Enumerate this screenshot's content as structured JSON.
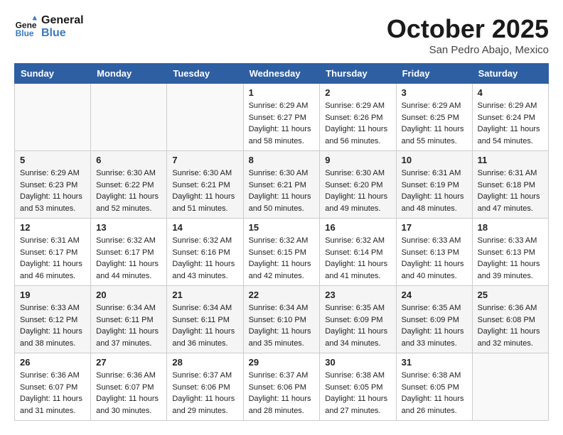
{
  "header": {
    "logo_line1": "General",
    "logo_line2": "Blue",
    "month": "October 2025",
    "location": "San Pedro Abajo, Mexico"
  },
  "weekdays": [
    "Sunday",
    "Monday",
    "Tuesday",
    "Wednesday",
    "Thursday",
    "Friday",
    "Saturday"
  ],
  "weeks": [
    [
      {
        "day": "",
        "sunrise": "",
        "sunset": "",
        "daylight": ""
      },
      {
        "day": "",
        "sunrise": "",
        "sunset": "",
        "daylight": ""
      },
      {
        "day": "",
        "sunrise": "",
        "sunset": "",
        "daylight": ""
      },
      {
        "day": "1",
        "sunrise": "Sunrise: 6:29 AM",
        "sunset": "Sunset: 6:27 PM",
        "daylight": "Daylight: 11 hours and 58 minutes."
      },
      {
        "day": "2",
        "sunrise": "Sunrise: 6:29 AM",
        "sunset": "Sunset: 6:26 PM",
        "daylight": "Daylight: 11 hours and 56 minutes."
      },
      {
        "day": "3",
        "sunrise": "Sunrise: 6:29 AM",
        "sunset": "Sunset: 6:25 PM",
        "daylight": "Daylight: 11 hours and 55 minutes."
      },
      {
        "day": "4",
        "sunrise": "Sunrise: 6:29 AM",
        "sunset": "Sunset: 6:24 PM",
        "daylight": "Daylight: 11 hours and 54 minutes."
      }
    ],
    [
      {
        "day": "5",
        "sunrise": "Sunrise: 6:29 AM",
        "sunset": "Sunset: 6:23 PM",
        "daylight": "Daylight: 11 hours and 53 minutes."
      },
      {
        "day": "6",
        "sunrise": "Sunrise: 6:30 AM",
        "sunset": "Sunset: 6:22 PM",
        "daylight": "Daylight: 11 hours and 52 minutes."
      },
      {
        "day": "7",
        "sunrise": "Sunrise: 6:30 AM",
        "sunset": "Sunset: 6:21 PM",
        "daylight": "Daylight: 11 hours and 51 minutes."
      },
      {
        "day": "8",
        "sunrise": "Sunrise: 6:30 AM",
        "sunset": "Sunset: 6:21 PM",
        "daylight": "Daylight: 11 hours and 50 minutes."
      },
      {
        "day": "9",
        "sunrise": "Sunrise: 6:30 AM",
        "sunset": "Sunset: 6:20 PM",
        "daylight": "Daylight: 11 hours and 49 minutes."
      },
      {
        "day": "10",
        "sunrise": "Sunrise: 6:31 AM",
        "sunset": "Sunset: 6:19 PM",
        "daylight": "Daylight: 11 hours and 48 minutes."
      },
      {
        "day": "11",
        "sunrise": "Sunrise: 6:31 AM",
        "sunset": "Sunset: 6:18 PM",
        "daylight": "Daylight: 11 hours and 47 minutes."
      }
    ],
    [
      {
        "day": "12",
        "sunrise": "Sunrise: 6:31 AM",
        "sunset": "Sunset: 6:17 PM",
        "daylight": "Daylight: 11 hours and 46 minutes."
      },
      {
        "day": "13",
        "sunrise": "Sunrise: 6:32 AM",
        "sunset": "Sunset: 6:17 PM",
        "daylight": "Daylight: 11 hours and 44 minutes."
      },
      {
        "day": "14",
        "sunrise": "Sunrise: 6:32 AM",
        "sunset": "Sunset: 6:16 PM",
        "daylight": "Daylight: 11 hours and 43 minutes."
      },
      {
        "day": "15",
        "sunrise": "Sunrise: 6:32 AM",
        "sunset": "Sunset: 6:15 PM",
        "daylight": "Daylight: 11 hours and 42 minutes."
      },
      {
        "day": "16",
        "sunrise": "Sunrise: 6:32 AM",
        "sunset": "Sunset: 6:14 PM",
        "daylight": "Daylight: 11 hours and 41 minutes."
      },
      {
        "day": "17",
        "sunrise": "Sunrise: 6:33 AM",
        "sunset": "Sunset: 6:13 PM",
        "daylight": "Daylight: 11 hours and 40 minutes."
      },
      {
        "day": "18",
        "sunrise": "Sunrise: 6:33 AM",
        "sunset": "Sunset: 6:13 PM",
        "daylight": "Daylight: 11 hours and 39 minutes."
      }
    ],
    [
      {
        "day": "19",
        "sunrise": "Sunrise: 6:33 AM",
        "sunset": "Sunset: 6:12 PM",
        "daylight": "Daylight: 11 hours and 38 minutes."
      },
      {
        "day": "20",
        "sunrise": "Sunrise: 6:34 AM",
        "sunset": "Sunset: 6:11 PM",
        "daylight": "Daylight: 11 hours and 37 minutes."
      },
      {
        "day": "21",
        "sunrise": "Sunrise: 6:34 AM",
        "sunset": "Sunset: 6:11 PM",
        "daylight": "Daylight: 11 hours and 36 minutes."
      },
      {
        "day": "22",
        "sunrise": "Sunrise: 6:34 AM",
        "sunset": "Sunset: 6:10 PM",
        "daylight": "Daylight: 11 hours and 35 minutes."
      },
      {
        "day": "23",
        "sunrise": "Sunrise: 6:35 AM",
        "sunset": "Sunset: 6:09 PM",
        "daylight": "Daylight: 11 hours and 34 minutes."
      },
      {
        "day": "24",
        "sunrise": "Sunrise: 6:35 AM",
        "sunset": "Sunset: 6:09 PM",
        "daylight": "Daylight: 11 hours and 33 minutes."
      },
      {
        "day": "25",
        "sunrise": "Sunrise: 6:36 AM",
        "sunset": "Sunset: 6:08 PM",
        "daylight": "Daylight: 11 hours and 32 minutes."
      }
    ],
    [
      {
        "day": "26",
        "sunrise": "Sunrise: 6:36 AM",
        "sunset": "Sunset: 6:07 PM",
        "daylight": "Daylight: 11 hours and 31 minutes."
      },
      {
        "day": "27",
        "sunrise": "Sunrise: 6:36 AM",
        "sunset": "Sunset: 6:07 PM",
        "daylight": "Daylight: 11 hours and 30 minutes."
      },
      {
        "day": "28",
        "sunrise": "Sunrise: 6:37 AM",
        "sunset": "Sunset: 6:06 PM",
        "daylight": "Daylight: 11 hours and 29 minutes."
      },
      {
        "day": "29",
        "sunrise": "Sunrise: 6:37 AM",
        "sunset": "Sunset: 6:06 PM",
        "daylight": "Daylight: 11 hours and 28 minutes."
      },
      {
        "day": "30",
        "sunrise": "Sunrise: 6:38 AM",
        "sunset": "Sunset: 6:05 PM",
        "daylight": "Daylight: 11 hours and 27 minutes."
      },
      {
        "day": "31",
        "sunrise": "Sunrise: 6:38 AM",
        "sunset": "Sunset: 6:05 PM",
        "daylight": "Daylight: 11 hours and 26 minutes."
      },
      {
        "day": "",
        "sunrise": "",
        "sunset": "",
        "daylight": ""
      }
    ]
  ]
}
